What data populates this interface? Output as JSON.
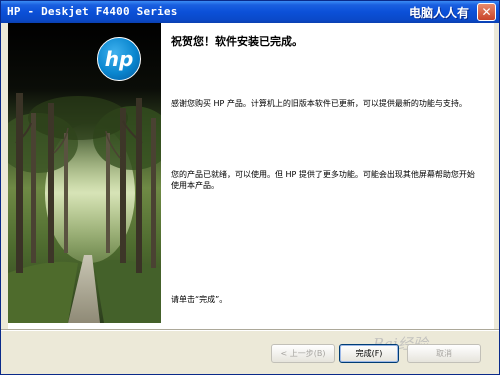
{
  "window": {
    "title": "HP - Deskjet F4400 Series",
    "brand": "电脑人人有",
    "close_glyph": "✕"
  },
  "logo": {
    "text": "hp"
  },
  "main": {
    "heading": "祝贺您！软件安装已完成。",
    "para1": "感谢您购买 HP 产品。计算机上的旧版本软件已更新，可以提供最新的功能与支持。",
    "para2": "您的产品已就绪，可以使用。但 HP 提供了更多功能。可能会出现其他屏幕帮助您开始使用本产品。",
    "para3": "请单击“完成”。"
  },
  "buttons": {
    "back": "< 上一步(B)",
    "finish": "完成(F)",
    "cancel": "取消"
  },
  "watermark": "Bai经验"
}
